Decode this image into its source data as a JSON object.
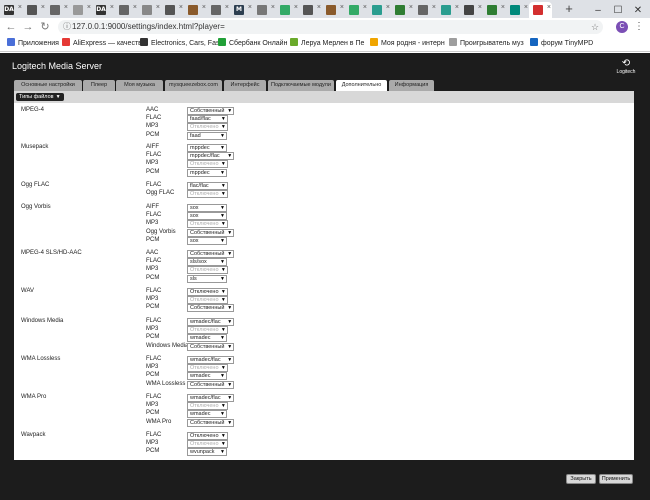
{
  "browser": {
    "tabs": [
      {
        "icon": "DA",
        "color": "#333"
      },
      {
        "icon": "",
        "color": "#555"
      },
      {
        "icon": "",
        "color": "#666"
      },
      {
        "icon": "",
        "color": "#999"
      },
      {
        "icon": "DA",
        "color": "#333"
      },
      {
        "icon": "",
        "color": "#666"
      },
      {
        "icon": "",
        "color": "#888"
      },
      {
        "icon": "",
        "color": "#555"
      },
      {
        "icon": "",
        "color": "#8a5a2b"
      },
      {
        "icon": "",
        "color": "#666"
      },
      {
        "icon": "M",
        "color": "#2c3e50"
      },
      {
        "icon": "",
        "color": "#777"
      },
      {
        "icon": "",
        "color": "#3a6"
      },
      {
        "icon": "",
        "color": "#555"
      },
      {
        "icon": "",
        "color": "#8a5a2b"
      },
      {
        "icon": "",
        "color": "#3a6"
      },
      {
        "icon": "",
        "color": "#2a9d8f"
      },
      {
        "icon": "",
        "color": "#2e7d32"
      },
      {
        "icon": "",
        "color": "#666"
      },
      {
        "icon": "",
        "color": "#2a9d8f"
      },
      {
        "icon": "",
        "color": "#444"
      },
      {
        "icon": "",
        "color": "#2e7d32"
      },
      {
        "icon": "",
        "color": "#00897b"
      },
      {
        "icon": "",
        "color": "#d32f2f"
      }
    ],
    "new_tab": "+",
    "url": "127.0.0.1:9000/settings/index.html?player=",
    "avatar_letter": "C",
    "bookmarks": [
      {
        "label": "Приложения",
        "color": "#4a6fd8"
      },
      {
        "label": "AliExpress — качеств",
        "color": "#e53935"
      },
      {
        "label": "Electronics, Cars, Fas",
        "color": "#333"
      },
      {
        "label": "Сбербанк Онлайн",
        "color": "#21a038"
      },
      {
        "label": "Леруа Мерлен в Пе",
        "color": "#6aaa2b"
      },
      {
        "label": "Моя родня - интерн",
        "color": "#f0a500"
      },
      {
        "label": "Проигрыватель муз",
        "color": "#9e9e9e"
      },
      {
        "label": "форум TinyMPD",
        "color": "#1565c0"
      }
    ]
  },
  "lms": {
    "title": "Logitech Media Server",
    "logo_text": "Logitech",
    "tabs": [
      "Основные настройки",
      "Плеер",
      "Моя музыка",
      "mysqueezebox.com",
      "Интерфейс",
      "Подключаемые модули",
      "Дополнительно",
      "Информация"
    ],
    "active_tab": 6,
    "filetypes_label": "Типы файлов",
    "sections": [
      {
        "name": "MPEG-4",
        "rows": [
          {
            "label": "AAC",
            "value": "Собственный",
            "disabled": false
          },
          {
            "label": "FLAC",
            "value": "faad/flac",
            "disabled": false
          },
          {
            "label": "MP3",
            "value": "Отключено",
            "disabled": true
          },
          {
            "label": "PCM",
            "value": "faad",
            "disabled": false
          }
        ]
      },
      {
        "name": "Musepack",
        "rows": [
          {
            "label": "AIFF",
            "value": "mppdec",
            "disabled": false
          },
          {
            "label": "FLAC",
            "value": "mppdec/flac",
            "disabled": false
          },
          {
            "label": "MP3",
            "value": "Отключено",
            "disabled": true
          },
          {
            "label": "PCM",
            "value": "mppdec",
            "disabled": false
          }
        ]
      },
      {
        "name": "Ogg FLAC",
        "rows": [
          {
            "label": "FLAC",
            "value": "flac/flac",
            "disabled": false
          },
          {
            "label": "Ogg FLAC",
            "value": "Отключено",
            "disabled": true
          }
        ]
      },
      {
        "name": "Ogg Vorbis",
        "rows": [
          {
            "label": "AIFF",
            "value": "sox",
            "disabled": false
          },
          {
            "label": "FLAC",
            "value": "sox",
            "disabled": false
          },
          {
            "label": "MP3",
            "value": "Отключено",
            "disabled": true
          },
          {
            "label": "Ogg Vorbis",
            "value": "Собственный",
            "disabled": false
          },
          {
            "label": "PCM",
            "value": "sox",
            "disabled": false
          }
        ]
      },
      {
        "name": "MPEG-4 SLS/HD-AAC",
        "rows": [
          {
            "label": "AAC",
            "value": "Собственный",
            "disabled": false
          },
          {
            "label": "FLAC",
            "value": "sls/sox",
            "disabled": false
          },
          {
            "label": "MP3",
            "value": "Отключено",
            "disabled": true
          },
          {
            "label": "PCM",
            "value": "sls",
            "disabled": false
          }
        ]
      },
      {
        "name": "WAV",
        "rows": [
          {
            "label": "FLAC",
            "value": "Отключено",
            "disabled": false
          },
          {
            "label": "MP3",
            "value": "Отключено",
            "disabled": true
          },
          {
            "label": "PCM",
            "value": "Собственный",
            "disabled": false
          }
        ]
      },
      {
        "name": "Windows Media",
        "rows": [
          {
            "label": "FLAC",
            "value": "wmadec/flac",
            "disabled": false
          },
          {
            "label": "MP3",
            "value": "Отключено",
            "disabled": true
          },
          {
            "label": "PCM",
            "value": "wmadec",
            "disabled": false
          },
          {
            "label": "Windows Media",
            "value": "Собственный",
            "disabled": false
          }
        ]
      },
      {
        "name": "WMA Lossless",
        "rows": [
          {
            "label": "FLAC",
            "value": "wmadec/flac",
            "disabled": false
          },
          {
            "label": "MP3",
            "value": "Отключено",
            "disabled": true
          },
          {
            "label": "PCM",
            "value": "wmadec",
            "disabled": false
          },
          {
            "label": "WMA Lossless",
            "value": "Собственный",
            "disabled": false
          }
        ]
      },
      {
        "name": "WMA Pro",
        "rows": [
          {
            "label": "FLAC",
            "value": "wmadec/flac",
            "disabled": false
          },
          {
            "label": "MP3",
            "value": "Отключено",
            "disabled": true
          },
          {
            "label": "PCM",
            "value": "wmadec",
            "disabled": false
          },
          {
            "label": "WMA Pro",
            "value": "Собственный",
            "disabled": false
          }
        ]
      },
      {
        "name": "Wavpack",
        "rows": [
          {
            "label": "FLAC",
            "value": "Отключено",
            "disabled": false
          },
          {
            "label": "MP3",
            "value": "Отключено",
            "disabled": true
          },
          {
            "label": "PCM",
            "value": "wvunpack",
            "disabled": false
          }
        ]
      }
    ],
    "close_label": "Закрыть",
    "apply_label": "Применить"
  }
}
